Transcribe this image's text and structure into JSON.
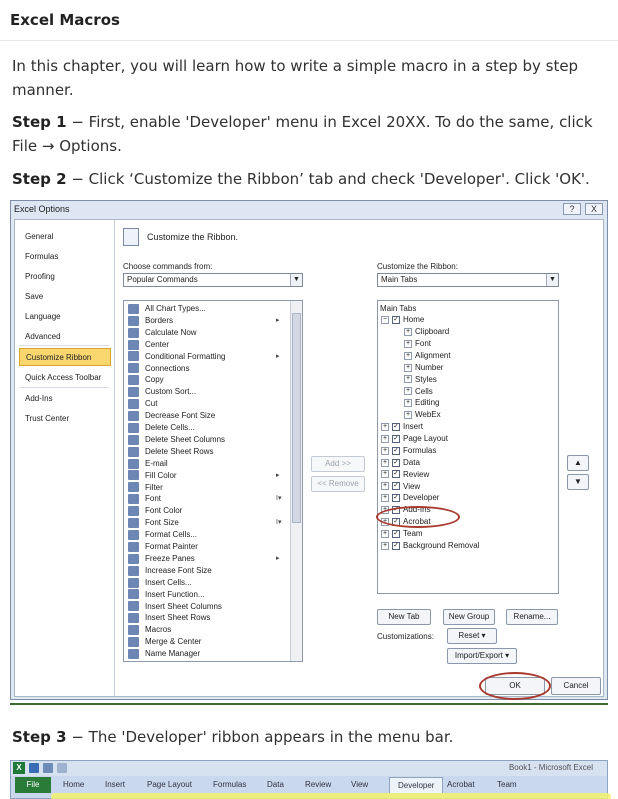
{
  "heading": "Excel Macros",
  "intro": "In this chapter, you will learn how to write a simple macro in a step by step manner.",
  "step1": {
    "label": "Step 1",
    "text": " − First, enable 'Developer' menu in Excel 20XX. To do the same, click File → Options."
  },
  "step2": {
    "label": "Step 2",
    "text": " − Click ‘Customize the Ribbon’ tab and check 'Developer'. Click 'OK'."
  },
  "step3": {
    "label": "Step 3",
    "text": " − The 'Developer' ribbon appears in the menu bar."
  },
  "dialog": {
    "title": "Excel Options",
    "help": "?",
    "close": "X",
    "nav": [
      "General",
      "Formulas",
      "Proofing",
      "Save",
      "Language",
      "Advanced",
      "Customize Ribbon",
      "Quick Access Toolbar",
      "Add-Ins",
      "Trust Center"
    ],
    "header": "Customize the Ribbon.",
    "choose_label": "Choose commands from:",
    "choose_value": "Popular Commands",
    "customize_label": "Customize the Ribbon:",
    "customize_value": "Main Tabs",
    "commands": [
      "All Chart Types...",
      "Borders",
      "Calculate Now",
      "Center",
      "Conditional Formatting",
      "Connections",
      "Copy",
      "Custom Sort...",
      "Cut",
      "Decrease Font Size",
      "Delete Cells...",
      "Delete Sheet Columns",
      "Delete Sheet Rows",
      "E-mail",
      "Fill Color",
      "Filter",
      "Font",
      "Font Color",
      "Font Size",
      "Format Cells...",
      "Format Painter",
      "Freeze Panes",
      "Increase Font Size",
      "Insert Cells...",
      "Insert Function...",
      "Insert Sheet Columns",
      "Insert Sheet Rows",
      "Macros",
      "Merge & Center",
      "Name Manager"
    ],
    "add_btn": "Add >>",
    "remove_btn": "<< Remove",
    "tree_header": "Main Tabs",
    "home": "Home",
    "home_groups": [
      "Clipboard",
      "Font",
      "Alignment",
      "Number",
      "Styles",
      "Cells",
      "Editing",
      "WebEx"
    ],
    "tabs": [
      "Insert",
      "Page Layout",
      "Formulas",
      "Data",
      "Review",
      "View",
      "Developer",
      "Add-Ins",
      "Acrobat",
      "Team",
      "Background Removal"
    ],
    "new_tab": "New Tab",
    "new_group": "New Group",
    "rename": "Rename...",
    "customizations_label": "Customizations:",
    "reset": "Reset ▾",
    "import_export": "Import/Export ▾",
    "ok": "OK",
    "cancel": "Cancel"
  },
  "ribbon": {
    "book": "Book1 - Microsoft Excel",
    "file": "File",
    "tabs": [
      "Home",
      "Insert",
      "Page Layout",
      "Formulas",
      "Data",
      "Review",
      "View",
      "Developer",
      "Acrobat",
      "Team"
    ]
  },
  "colors": {
    "accent_highlight": "#f9d66e",
    "circle": "#a83a2e",
    "rule": "#3b6b2e"
  }
}
